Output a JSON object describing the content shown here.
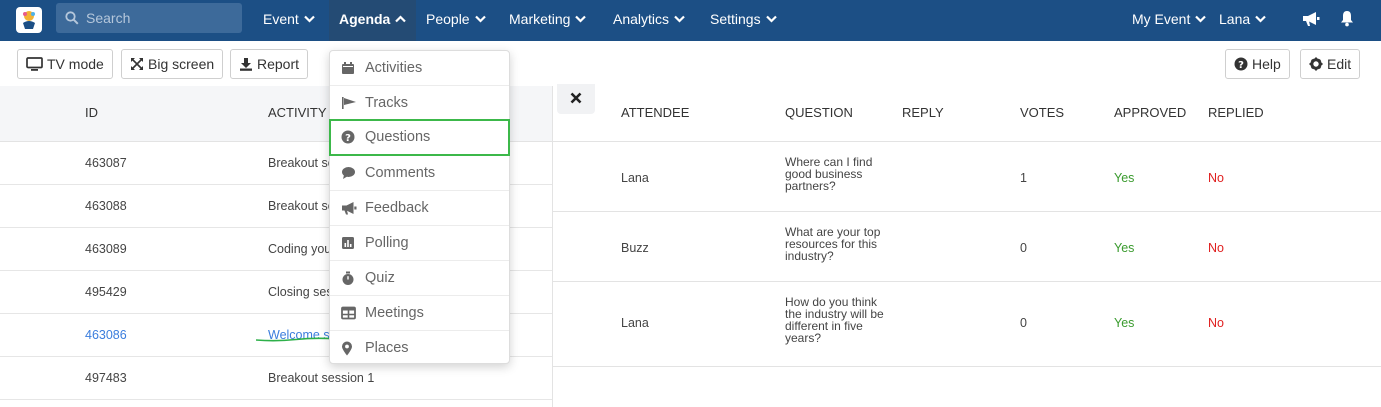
{
  "nav": {
    "search_placeholder": "Search",
    "items": [
      {
        "label": "Event"
      },
      {
        "label": "Agenda"
      },
      {
        "label": "People"
      },
      {
        "label": "Marketing"
      },
      {
        "label": "Analytics"
      },
      {
        "label": "Settings"
      }
    ],
    "right": {
      "event_label": "My Event",
      "user_label": "Lana"
    },
    "colors": {
      "bar": "#1c4f85",
      "active": "#244b74"
    }
  },
  "toolbar": {
    "tv_mode": "TV mode",
    "big_screen": "Big screen",
    "report": "Report",
    "help": "Help",
    "edit": "Edit"
  },
  "agenda_menu": {
    "items": [
      {
        "label": "Activities",
        "icon": "calendar-icon"
      },
      {
        "label": "Tracks",
        "icon": "flag-icon"
      },
      {
        "label": "Questions",
        "icon": "question-circle-icon",
        "highlighted": true
      },
      {
        "label": "Comments",
        "icon": "comment-icon"
      },
      {
        "label": "Feedback",
        "icon": "megaphone-icon"
      },
      {
        "label": "Polling",
        "icon": "bar-chart-icon"
      },
      {
        "label": "Quiz",
        "icon": "stopwatch-icon"
      },
      {
        "label": "Meetings",
        "icon": "table-icon"
      },
      {
        "label": "Places",
        "icon": "map-marker-icon"
      }
    ]
  },
  "activities": {
    "headers": {
      "id": "ID",
      "name": "ACTIVITY N"
    },
    "rows": [
      {
        "id": "463087",
        "name": "Breakout se"
      },
      {
        "id": "463088",
        "name": "Breakout se"
      },
      {
        "id": "463089",
        "name": "Coding you"
      },
      {
        "id": "495429",
        "name": "Closing sess"
      },
      {
        "id": "463086",
        "name": "Welcome se",
        "selected": true
      },
      {
        "id": "497483",
        "name": "Breakout session 1"
      }
    ]
  },
  "questions": {
    "headers": {
      "attendee": "ATTENDEE",
      "question": "QUESTION",
      "reply": "REPLY",
      "votes": "VOTES",
      "approved": "APPROVED",
      "replied": "REPLIED"
    },
    "rows": [
      {
        "attendee": "Lana",
        "question": [
          "Where can I find",
          "good business",
          "partners?"
        ],
        "reply": "",
        "votes": "1",
        "approved": "Yes",
        "replied": "No"
      },
      {
        "attendee": "Buzz",
        "question": [
          "What are your top",
          "resources for this",
          "industry?"
        ],
        "reply": "",
        "votes": "0",
        "approved": "Yes",
        "replied": "No"
      },
      {
        "attendee": "Lana",
        "question": [
          "How do you think",
          "the industry will be",
          "different in five",
          "years?"
        ],
        "reply": "",
        "votes": "0",
        "approved": "Yes",
        "replied": "No"
      }
    ]
  }
}
